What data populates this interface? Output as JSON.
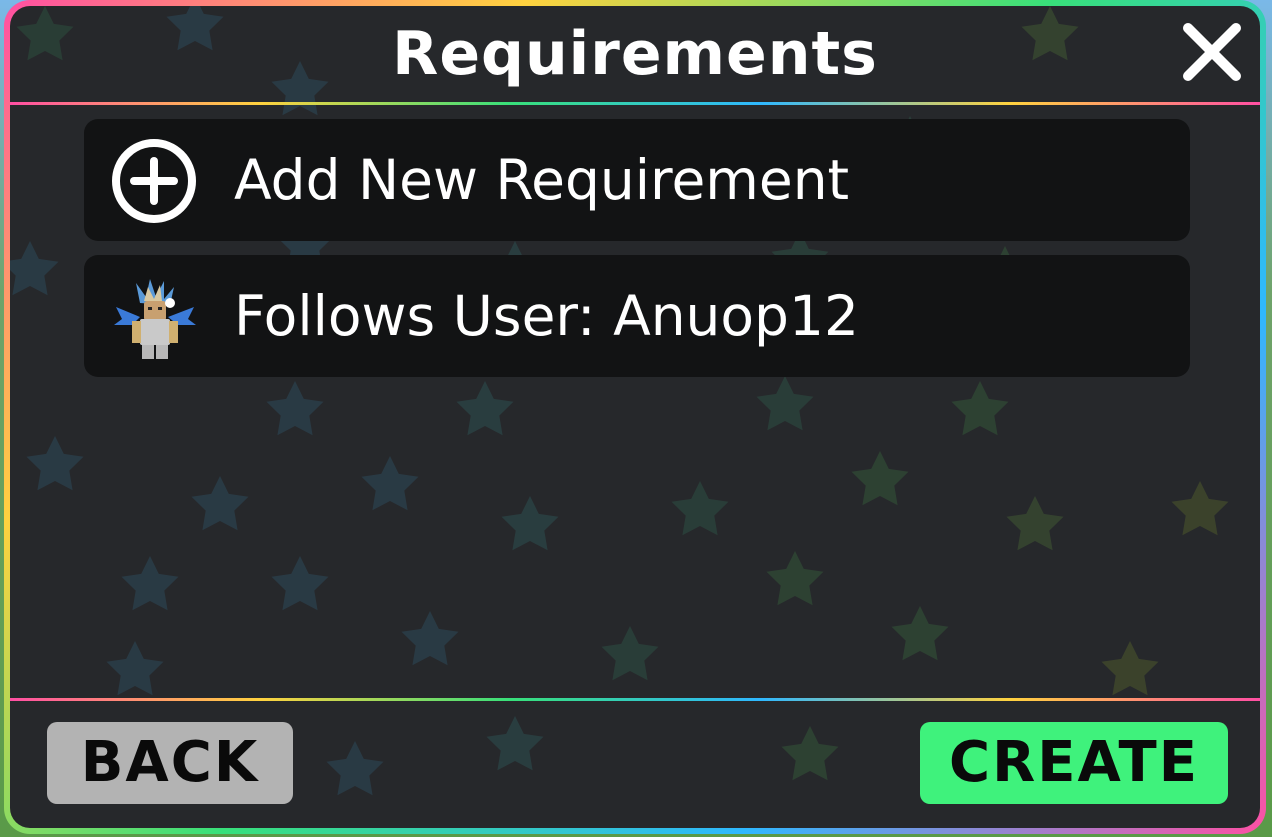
{
  "header": {
    "title": "Requirements",
    "close_icon": "close-icon"
  },
  "requirements": {
    "items": [
      {
        "label": "Add New Requirement",
        "icon": "add-circle-icon"
      },
      {
        "label": "Follows User: Anuop12",
        "icon": "user-avatar"
      }
    ]
  },
  "footer": {
    "back_label": "BACK",
    "create_label": "CREATE"
  },
  "colors": {
    "panel_background": "#26282b",
    "row_background": "#121314",
    "back_button": "#b3b3b3",
    "create_button": "#3ff27c",
    "text": "#ffffff"
  }
}
